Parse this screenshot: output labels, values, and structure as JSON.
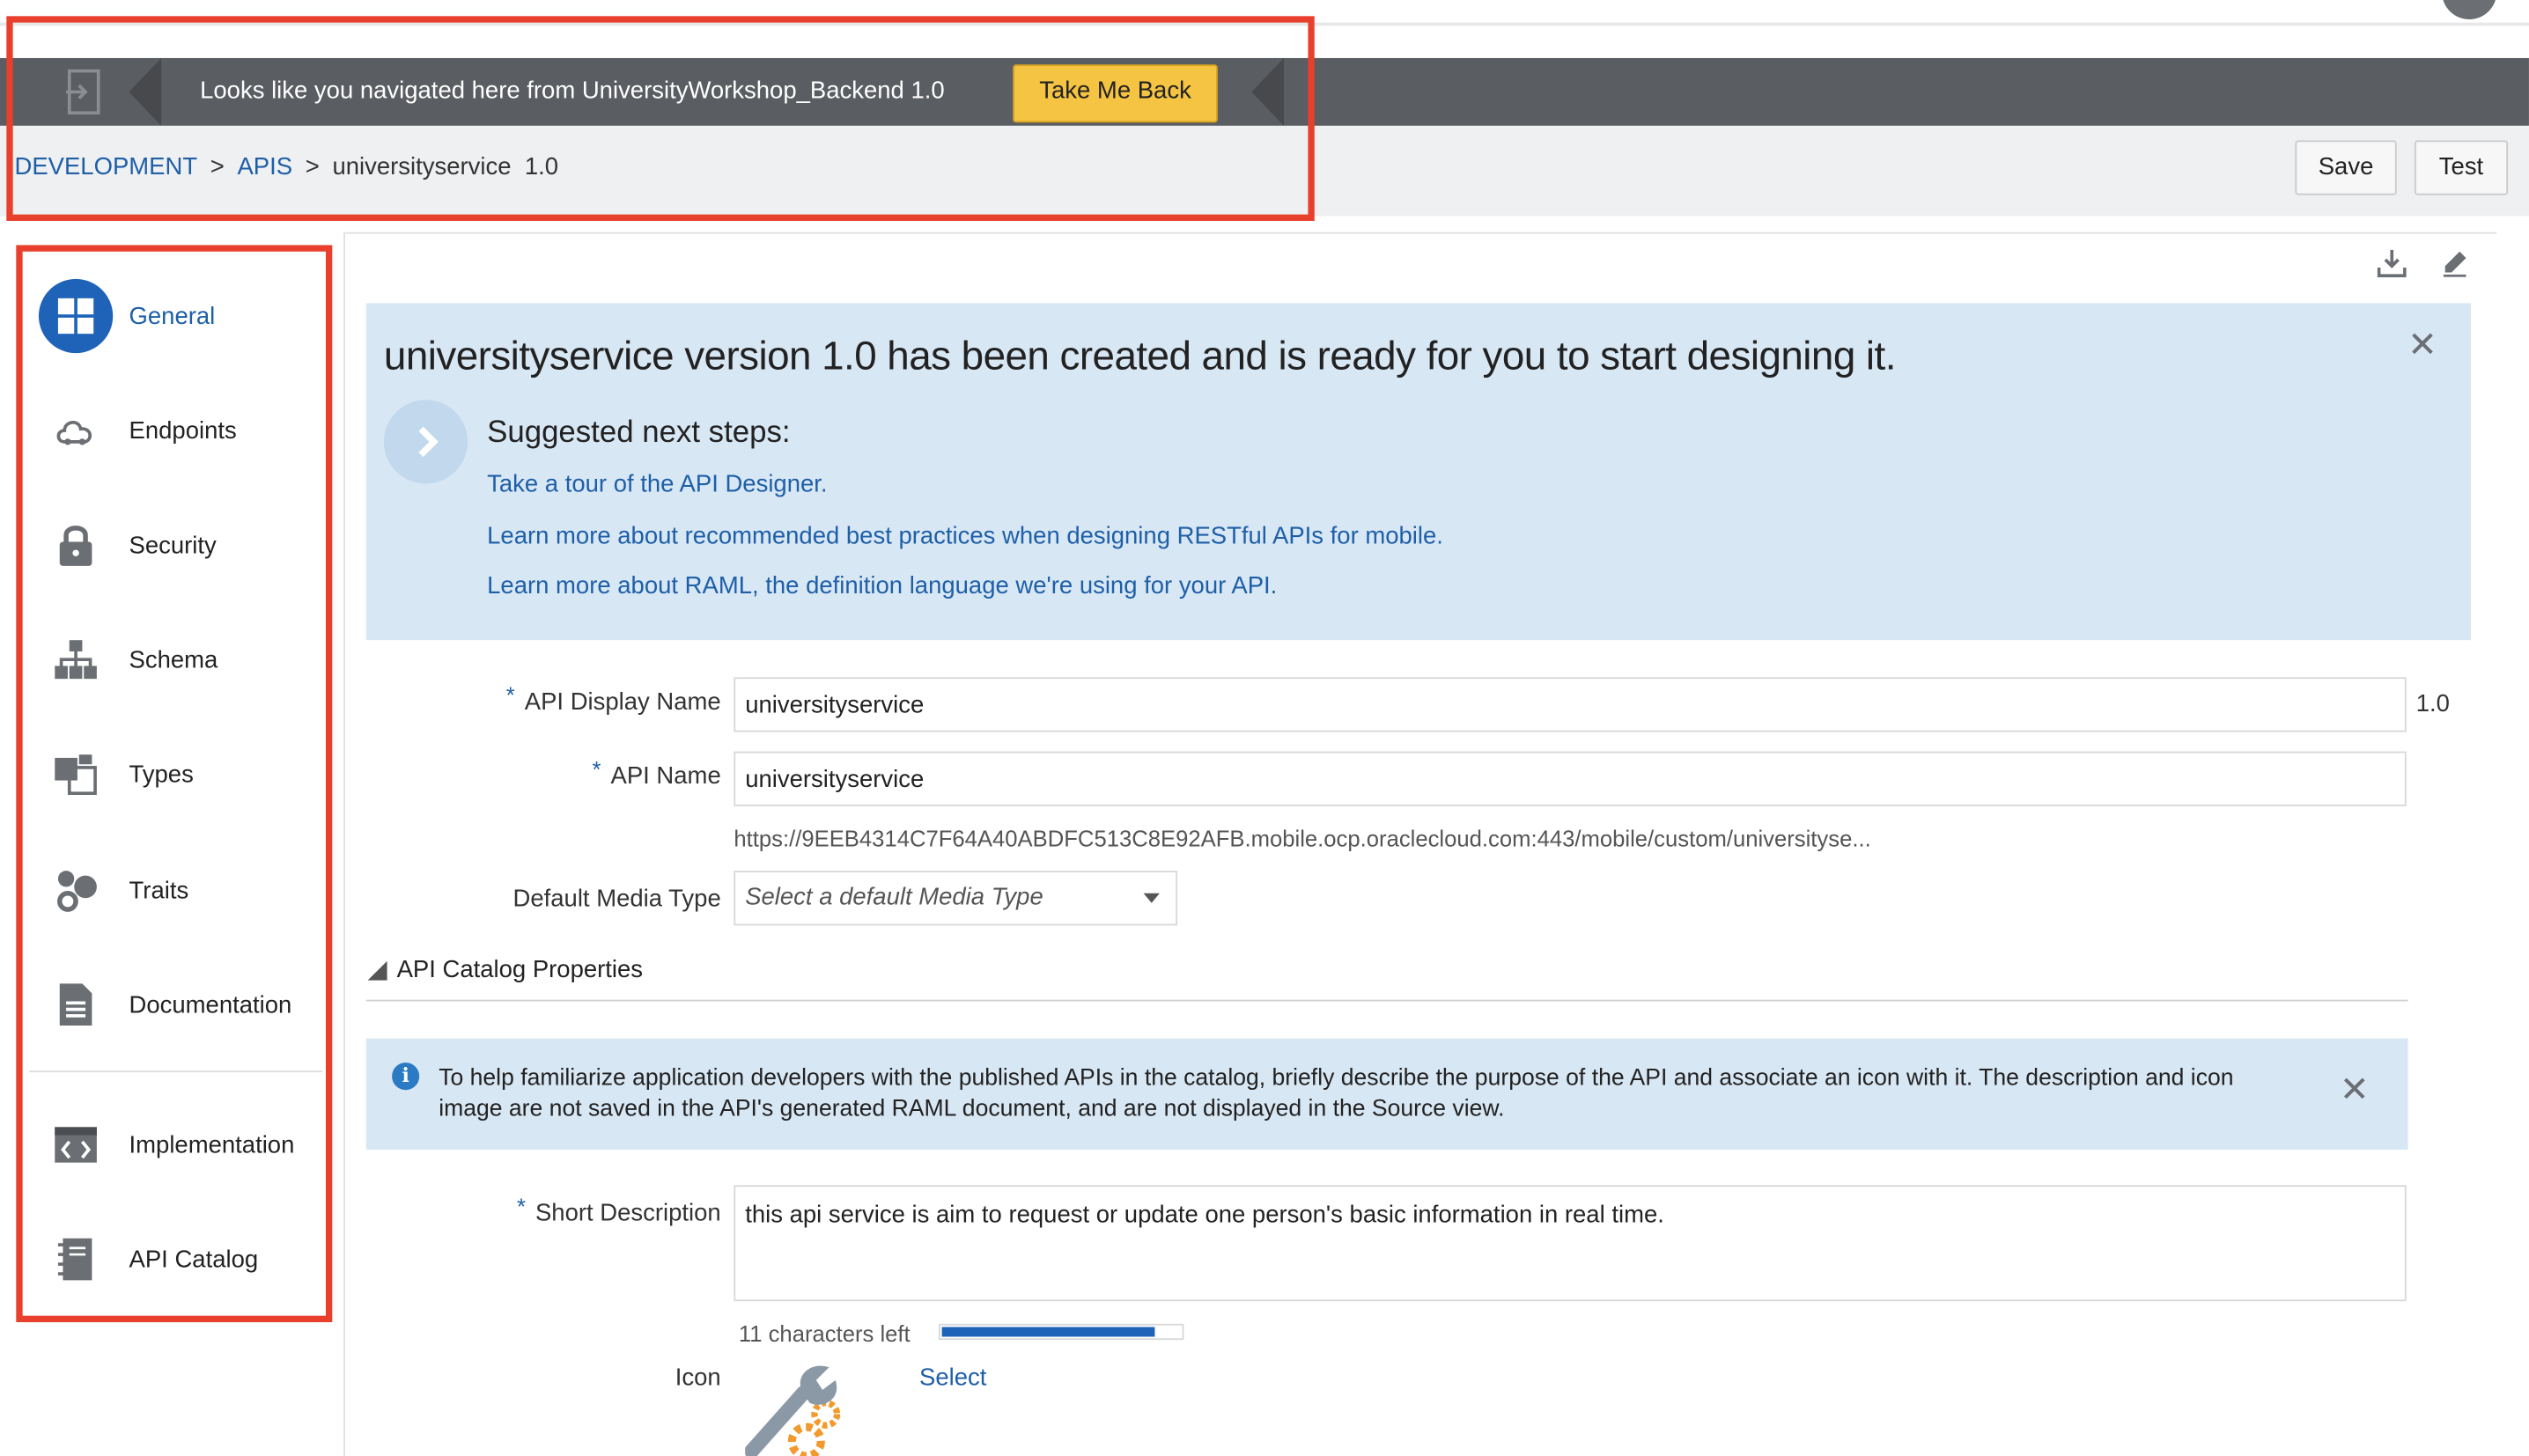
{
  "return_bar": {
    "message": "Looks like you navigated here from UniversityWorkshop_Backend 1.0",
    "button_label": "Take Me Back"
  },
  "breadcrumb": {
    "items": [
      "DEVELOPMENT",
      "APIS"
    ],
    "separator": ">",
    "current": "universityservice",
    "version": "1.0"
  },
  "header_actions": {
    "save_label": "Save",
    "test_label": "Test"
  },
  "sidebar": {
    "items": [
      {
        "label": "General",
        "icon": "grid-icon",
        "active": true
      },
      {
        "label": "Endpoints",
        "icon": "cloud-icon",
        "active": false
      },
      {
        "label": "Security",
        "icon": "lock-icon",
        "active": false
      },
      {
        "label": "Schema",
        "icon": "hierarchy-icon",
        "active": false
      },
      {
        "label": "Types",
        "icon": "types-icon",
        "active": false
      },
      {
        "label": "Traits",
        "icon": "traits-icon",
        "active": false
      },
      {
        "label": "Documentation",
        "icon": "document-icon",
        "active": false
      },
      {
        "label": "Implementation",
        "icon": "code-icon",
        "active": false
      },
      {
        "label": "API Catalog",
        "icon": "catalog-icon",
        "active": false
      }
    ]
  },
  "toolbar": {
    "download_icon": "download-icon",
    "edit_icon": "edit-icon"
  },
  "banner": {
    "title": "universityservice version 1.0 has been created and is ready for you to start designing it.",
    "subtitle": "Suggested next steps:",
    "links": [
      "Take a tour of the API Designer.",
      "Learn more about recommended best practices when designing RESTful APIs for mobile.",
      "Learn more about RAML, the definition language we're using for your API."
    ]
  },
  "form": {
    "display_name_label": "API Display Name",
    "display_name_value": "universityservice",
    "version": "1.0",
    "api_name_label": "API Name",
    "api_name_value": "universityservice",
    "url": "https://9EEB4314C7F64A40ABDFC513C8E92AFB.mobile.ocp.oraclecloud.com:443/mobile/custom/universityse...",
    "media_type_label": "Default Media Type",
    "media_type_placeholder": "Select a default Media Type",
    "required_marker": "*"
  },
  "catalog": {
    "section_title": "API Catalog Properties",
    "info_text": "To help familiarize application developers with the published APIs in the catalog, briefly describe the purpose of the API and associate an icon with it. The description and icon image are not saved in the API's generated RAML document, and are not displayed in the Source view.",
    "short_desc_label": "Short Description",
    "short_desc_value": "this api service is aim to request or update one person's basic information in real time.",
    "chars_left": "11 characters left",
    "chars_used_fraction": 0.89,
    "icon_label": "Icon",
    "select_label": "Select"
  },
  "colors": {
    "accent": "#1e5fa8",
    "annotation": "#e8402c",
    "return_bar": "#5a5d61",
    "take_back": "#f6c443",
    "banner_bg": "#d8e7f4"
  }
}
